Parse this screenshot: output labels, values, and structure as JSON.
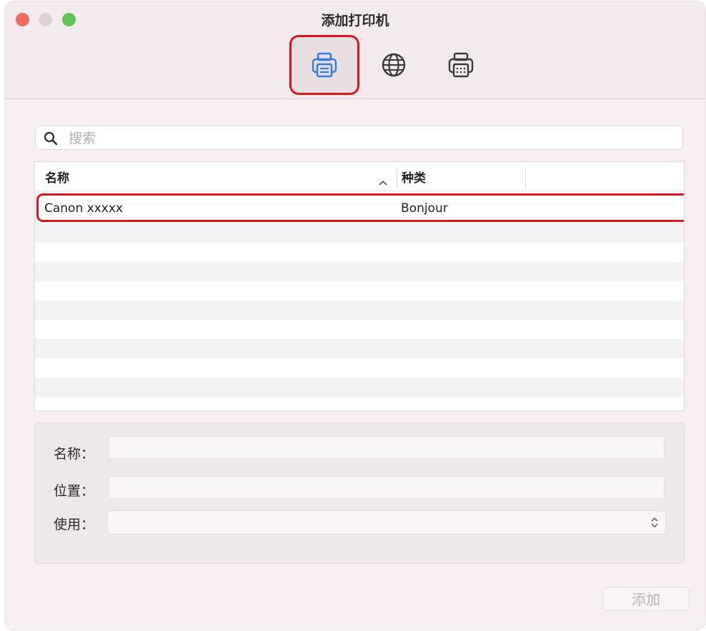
{
  "window": {
    "title": "添加打印机"
  },
  "toolbar": {
    "buttons": [
      {
        "icon": "default-printer-icon",
        "selected": true
      },
      {
        "icon": "ip-globe-icon",
        "selected": false
      },
      {
        "icon": "windows-printer-icon",
        "selected": false
      }
    ]
  },
  "search": {
    "placeholder": "搜索",
    "value": ""
  },
  "table": {
    "columns": [
      {
        "label": "名称",
        "sort": "ascending"
      },
      {
        "label": "种类"
      }
    ],
    "rows": [
      {
        "name": "Canon xxxxx",
        "kind": "Bonjour",
        "highlighted": true
      }
    ]
  },
  "details": {
    "name_label": "名称：",
    "name_value": "",
    "location_label": "位置：",
    "location_value": "",
    "use_label": "使用：",
    "use_value": ""
  },
  "actions": {
    "add_label": "添加",
    "add_enabled": false
  },
  "colors": {
    "highlight": "#e0141e",
    "accent": "#2f7ce8",
    "window_bg": "#f6eef0"
  }
}
